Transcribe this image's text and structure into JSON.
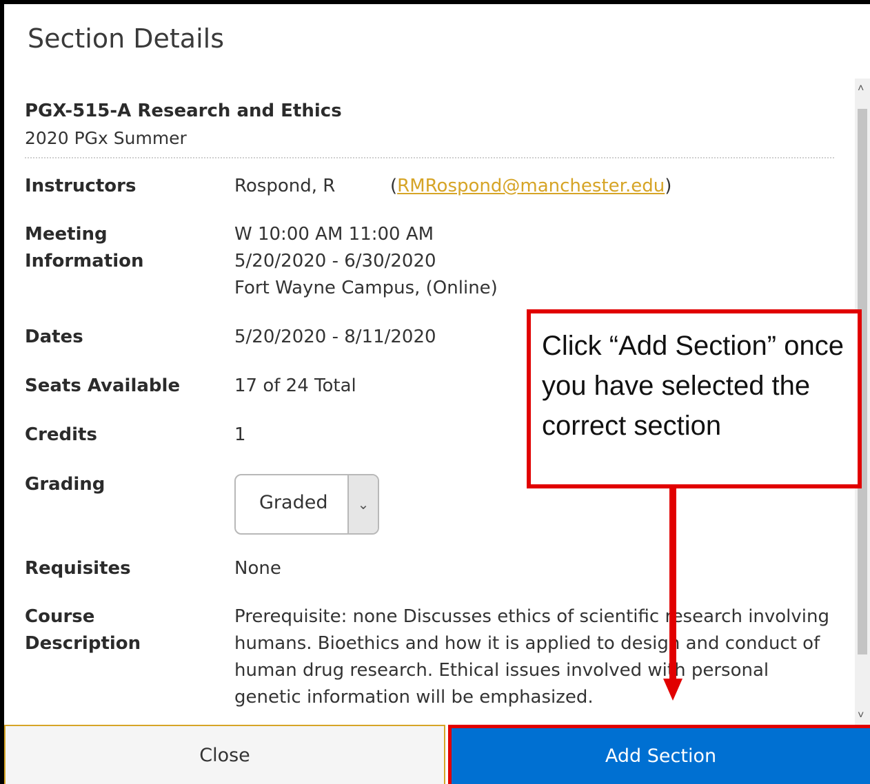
{
  "dialog": {
    "title": "Section Details",
    "course_title": "PGX-515-A Research and Ethics",
    "term": "2020 PGx Summer"
  },
  "details": {
    "instructors": {
      "label": "Instructors",
      "name": "Rospond, R",
      "email": "RMRospond@manchester.edu"
    },
    "meeting": {
      "label_line1": "Meeting",
      "label_line2": "Information",
      "line1": "W 10:00 AM 11:00 AM",
      "line2": "5/20/2020 - 6/30/2020",
      "line3": "Fort Wayne Campus, (Online)"
    },
    "dates": {
      "label": "Dates",
      "value": "5/20/2020 - 8/11/2020"
    },
    "seats": {
      "label": "Seats Available",
      "value": "17 of 24 Total"
    },
    "credits": {
      "label": "Credits",
      "value": "1"
    },
    "grading": {
      "label": "Grading",
      "selected": "Graded"
    },
    "requisites": {
      "label": "Requisites",
      "value": "None"
    },
    "description": {
      "label_line1": "Course",
      "label_line2": "Description",
      "value": "Prerequisite: none Discusses ethics of scientific research involving humans. Bioethics and how it is applied to design and conduct of human drug research. Ethical issues involved with personal genetic information will be emphasized."
    }
  },
  "footer": {
    "close_label": "Close",
    "add_label": "Add Section"
  },
  "annotation": {
    "callout_text": "Click “Add Section” once you have selected the correct section",
    "color": "#e10000"
  },
  "colors": {
    "primary_button": "#0070d2",
    "link": "#d6a426"
  }
}
